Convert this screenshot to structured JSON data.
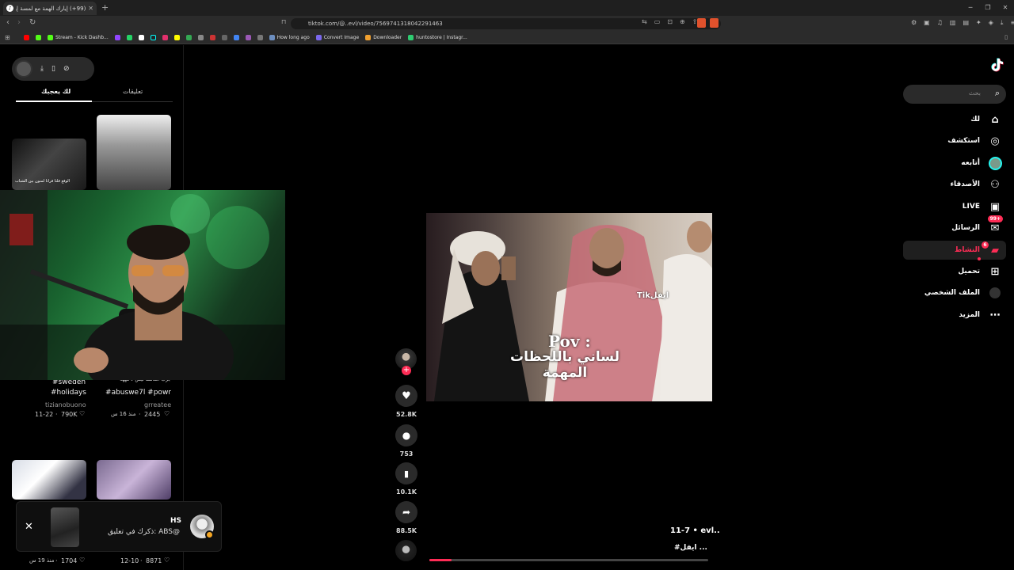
{
  "browser": {
    "tab_title": "(99+) إيارك الهمة مع لمسة إيفل",
    "url": "tiktok.com/@..evl/video/7569741318042291463",
    "bookmarks": [
      "Stream - Kick Dashb...",
      "How long ago",
      "Convert Image",
      "Downloader",
      "huntostore | Instagr..."
    ]
  },
  "left_panel": {
    "tabs": [
      "لك يعجبك",
      "تعليقات"
    ],
    "videos": [
      {
        "caption": "#sweden #holidays",
        "author": "tizianobuono",
        "date": "11-22",
        "likes": "790K"
      },
      {
        "caption": "جرب المالشا ليش لا هههه #abuswe7l #powr",
        "author": "grreatee",
        "date": "منذ 16 س",
        "likes": "2445"
      },
      {
        "date": "منذ 19 س",
        "likes": "1704"
      },
      {
        "date": "12-10",
        "likes": "8871"
      }
    ],
    "thumb_texts": [
      "الوقع قلنا فراتا لمنون بين الشباب"
    ]
  },
  "notification": {
    "name": "HS",
    "message": "ذكرك في تعليق: ABS@"
  },
  "video": {
    "watermark": "Tikايفل",
    "pov": "Pov :",
    "caption": "لساني باللحظات المهمة",
    "author": "evl..",
    "date": "11-7",
    "description": "#ايفل ...",
    "progress": 0.08
  },
  "actions": {
    "likes": "52.8K",
    "comments": "753",
    "saves": "10.1K",
    "shares": "88.5K"
  },
  "sidebar": {
    "search_placeholder": "بحث",
    "items": [
      {
        "label": "لك"
      },
      {
        "label": "استكشف"
      },
      {
        "label": "أتابعه"
      },
      {
        "label": "الأصدقاء"
      },
      {
        "label": "LIVE"
      },
      {
        "label": "الرسائل",
        "badge": "99+"
      },
      {
        "label": "النشاط",
        "badge": "6"
      },
      {
        "label": "تحميل"
      },
      {
        "label": "الملف الشخصي"
      },
      {
        "label": "المزيد"
      }
    ]
  },
  "colors": {
    "accent": "#fe2c55",
    "background": "#000000"
  }
}
